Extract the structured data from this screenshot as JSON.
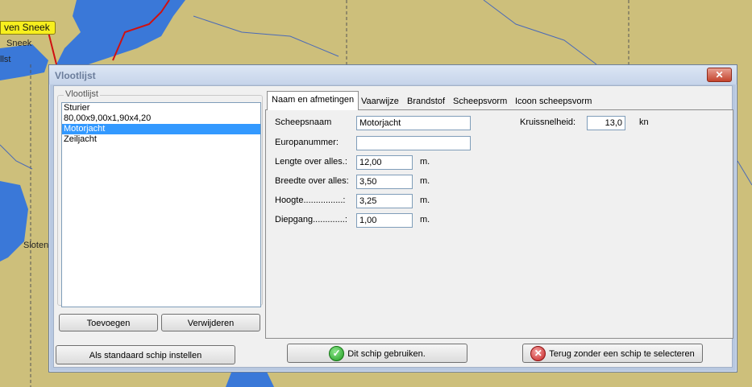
{
  "map": {
    "place_sneek_badge": "ven Sneek",
    "place_sneek": "Sneek",
    "place_ilst": "llst",
    "place_sloten": "Sloten"
  },
  "dialog": {
    "title": "Vlootlijst",
    "close_symbol": "✕",
    "group_label": "Vlootlijst",
    "fleet": [
      {
        "name": "Sturier",
        "selected": false
      },
      {
        "name": "80,00x9,00x1,90x4,20",
        "selected": false
      },
      {
        "name": "Motorjacht",
        "selected": true
      },
      {
        "name": "Zeiljacht",
        "selected": false
      }
    ],
    "add_label": "Toevoegen",
    "remove_label": "Verwijderen",
    "default_label": "Als standaard schip instellen",
    "use_label": "Dit schip gebruiken.",
    "cancel_label": "Terug zonder een schip te selecteren",
    "tabs": [
      {
        "label": "Naam en afmetingen",
        "active": true
      },
      {
        "label": "Vaarwijze",
        "active": false
      },
      {
        "label": "Brandstof",
        "active": false
      },
      {
        "label": "Scheepsvorm",
        "active": false
      },
      {
        "label": "Icoon scheepsvorm",
        "active": false
      }
    ],
    "form": {
      "shipname_label": "Scheepsnaam",
      "shipname_value": "Motorjacht",
      "euronr_label": "Europanummer:",
      "euronr_value": "",
      "length_label": "Lengte over alles.:",
      "length_value": "12,00",
      "width_label": "Breedte over alles:",
      "width_value": "3,50",
      "height_label": "Hoogte................:",
      "height_value": "3,25",
      "draft_label": "Diepgang.............:",
      "draft_value": "1,00",
      "unit_m": "m.",
      "speed_label": "Kruissnelheid:",
      "speed_value": "13,0",
      "speed_unit": "kn"
    }
  },
  "colors": {
    "land": "#cdbf7b",
    "water": "#3a78d8",
    "route": "#d01010",
    "selection": "#3399ff"
  }
}
